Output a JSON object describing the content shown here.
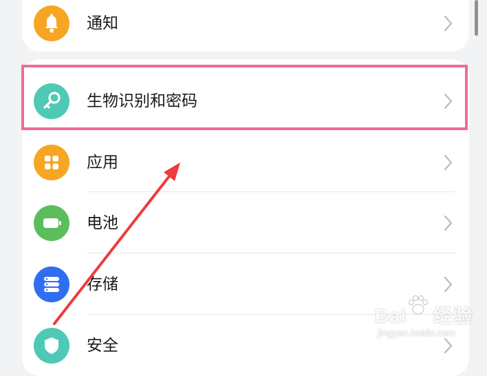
{
  "settings": {
    "items": [
      {
        "label": "通知",
        "icon": "bell-icon",
        "color": "#f6a623"
      },
      {
        "label": "生物识别和密码",
        "icon": "key-icon",
        "color": "#4ec9b6"
      },
      {
        "label": "应用",
        "icon": "apps-grid-icon",
        "color": "#f6a623"
      },
      {
        "label": "电池",
        "icon": "battery-icon",
        "color": "#5bbd5b"
      },
      {
        "label": "存储",
        "icon": "storage-icon",
        "color": "#2f6ef0"
      },
      {
        "label": "安全",
        "icon": "shield-icon",
        "color": "#4ec9b6"
      }
    ]
  },
  "annotation": {
    "highlight_color": "#f06b97",
    "arrow_color": "#ee3b3b",
    "highlighted_item": "生物识别和密码"
  },
  "watermark": {
    "brand": "Bai",
    "brand_suffix": "经验",
    "site": "jingyan.baidu.com"
  }
}
